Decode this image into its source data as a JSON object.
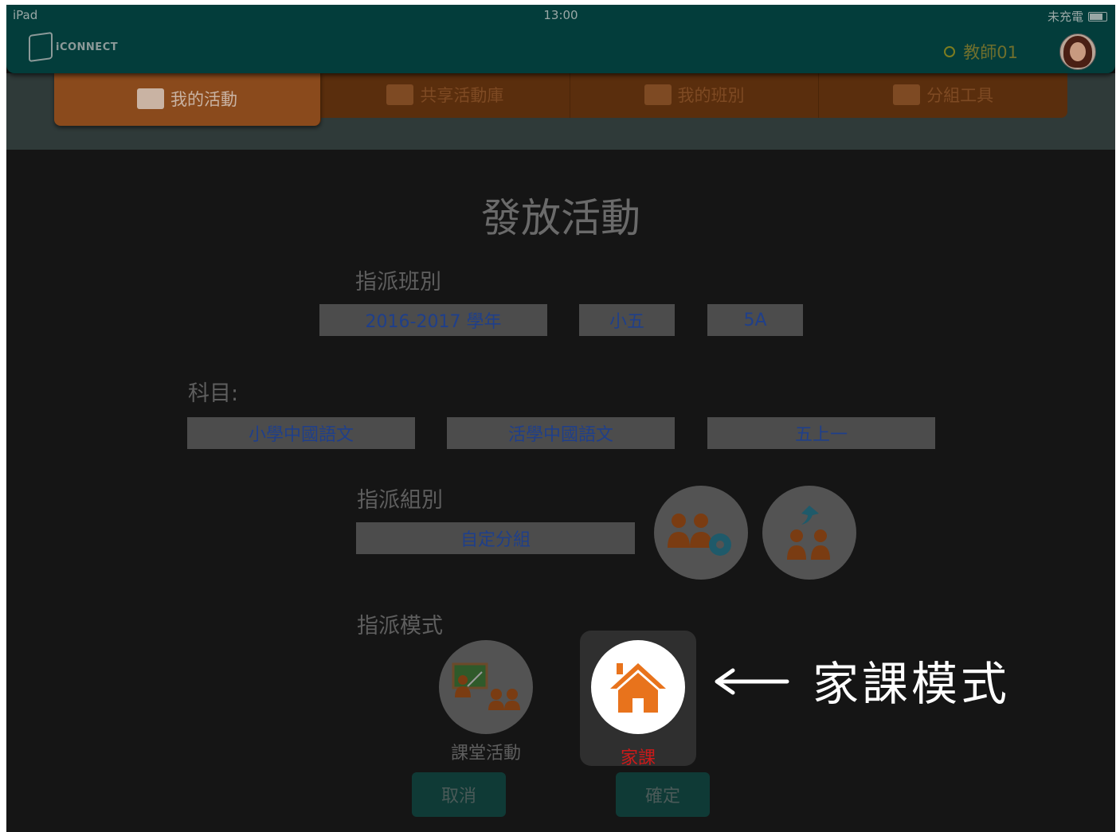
{
  "status_bar": {
    "device": "iPad",
    "time": "13:00",
    "battery_text": "未充電"
  },
  "app": {
    "logo": "iCONNECT",
    "user_name": "教師01"
  },
  "tabs": [
    {
      "label": "我的活動",
      "icon": "activity-icon"
    },
    {
      "label": "共享活動庫",
      "icon": "folder-share-icon"
    },
    {
      "label": "我的班別",
      "icon": "class-icon"
    },
    {
      "label": "分組工具",
      "icon": "group-tool-icon"
    }
  ],
  "page": {
    "title": "發放活動",
    "assign_class_label": "指派班別",
    "class_fields": [
      "2016-2017 學年",
      "小五",
      "5A"
    ],
    "subject_label": "科目:",
    "subject_fields": [
      "小學中國語文",
      "活學中國語文",
      "五上一"
    ],
    "assign_group_label": "指派組別",
    "group_value": "自定分組",
    "assign_mode_label": "指派模式",
    "mode_classroom_label": "課堂活動",
    "mode_homework_label": "家課",
    "cancel_label": "取消",
    "confirm_label": "確定"
  },
  "annotation": {
    "text": "家課模式"
  },
  "colors": {
    "header": "#033d3b",
    "active_tab": "#8a4a1c",
    "field_text": "#1f3f8a",
    "homework_label": "#cc1a1a",
    "house_orange": "#e8731c"
  }
}
